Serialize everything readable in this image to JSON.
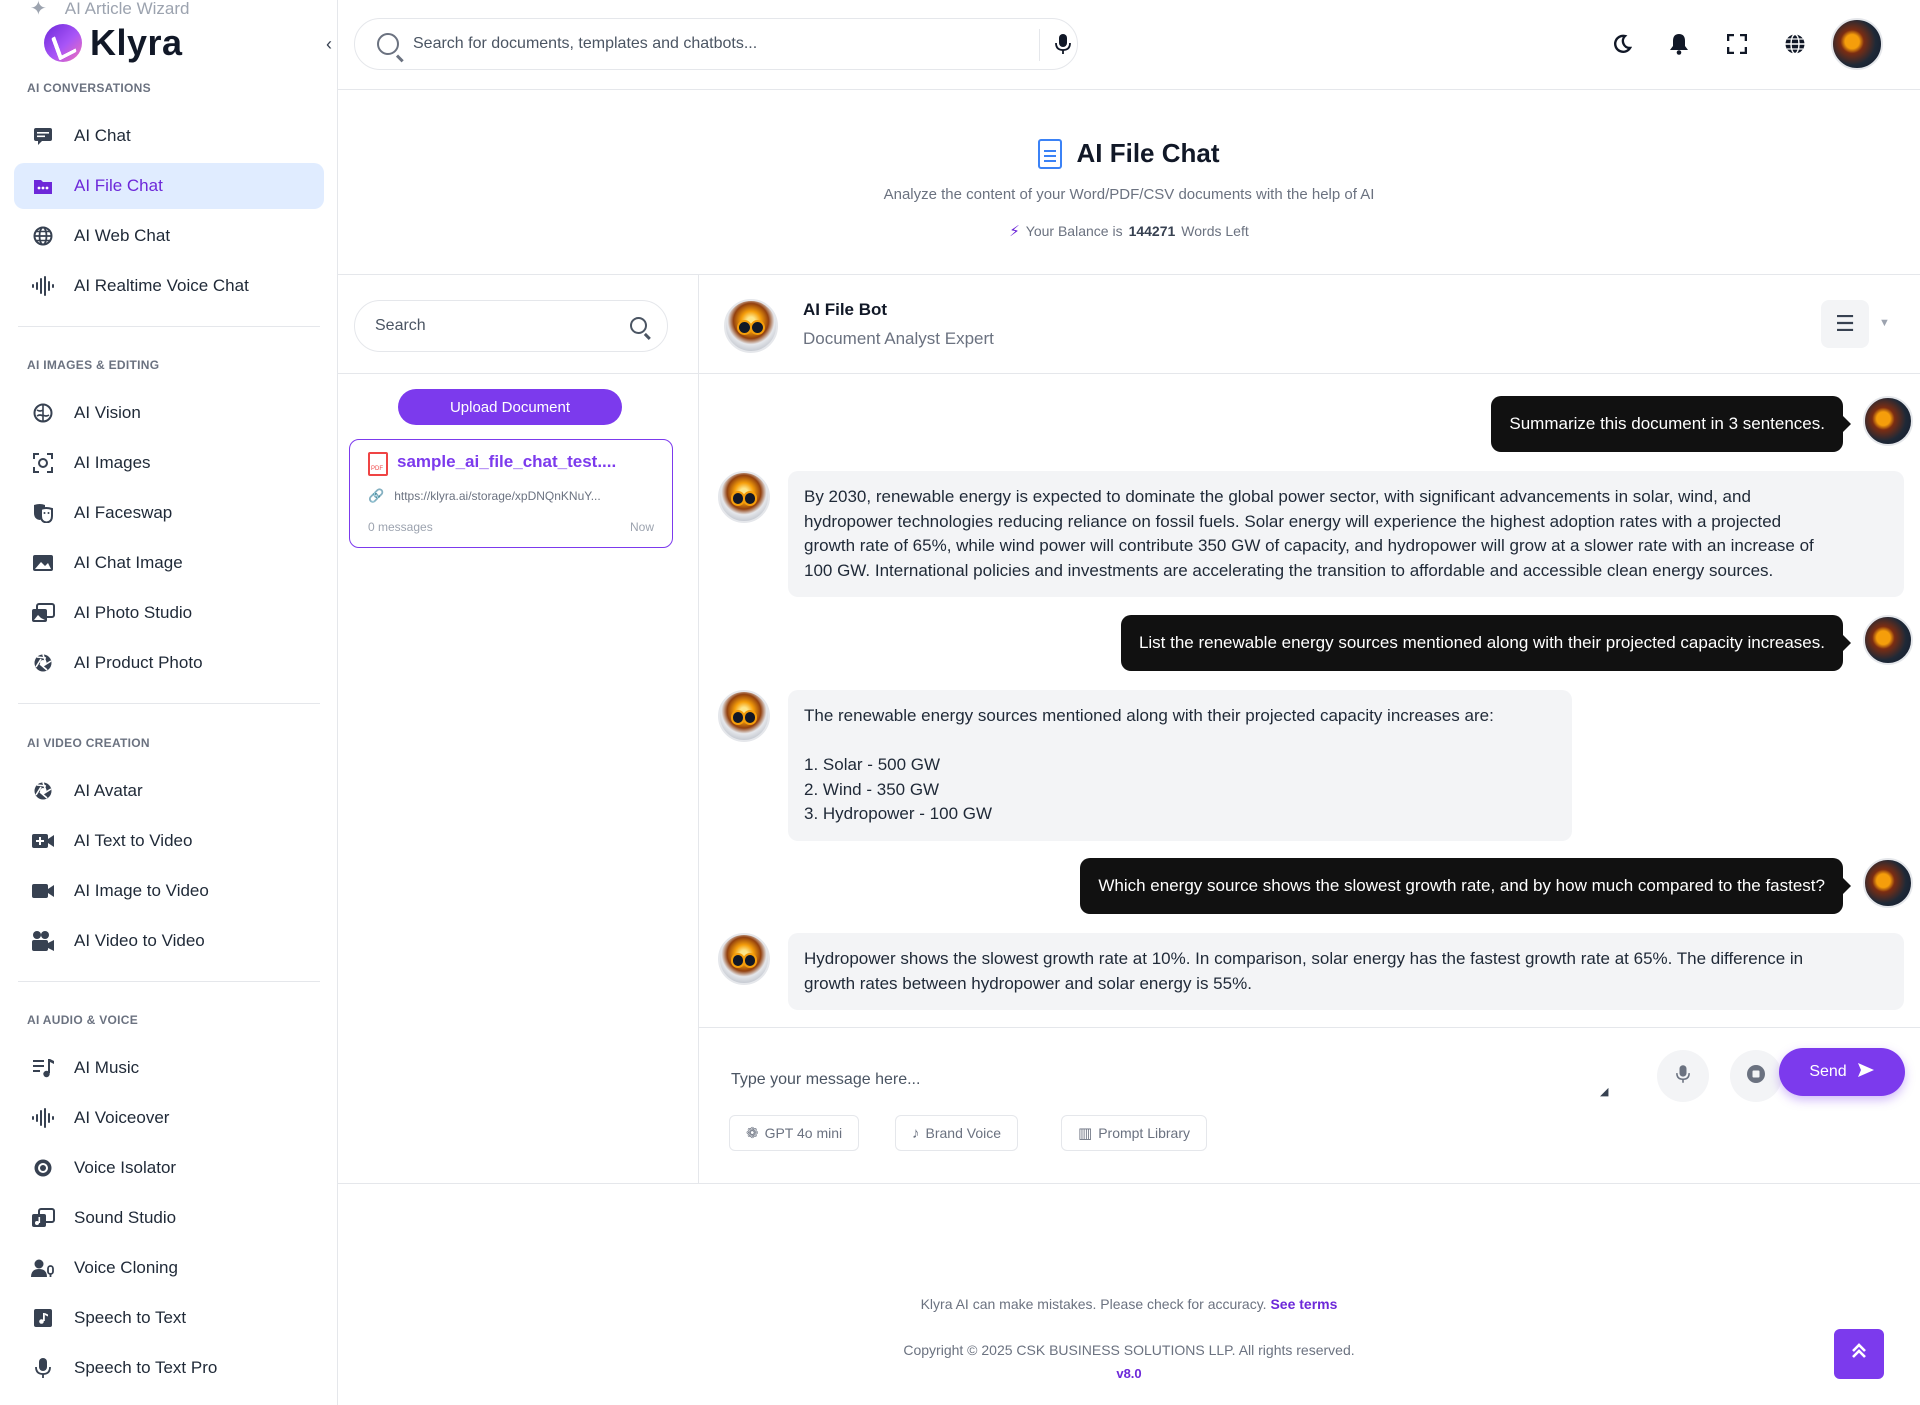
{
  "sidebar": {
    "peek_item": "AI Article Wizard",
    "brand": "Klyra",
    "sections": [
      {
        "label": "AI CONVERSATIONS",
        "items": [
          {
            "label": "AI Chat",
            "icon": "chat-icon"
          },
          {
            "label": "AI File Chat",
            "icon": "file-chat-icon",
            "active": true
          },
          {
            "label": "AI Web Chat",
            "icon": "globe-icon"
          },
          {
            "label": "AI Realtime Voice Chat",
            "icon": "waveform-icon"
          }
        ]
      },
      {
        "label": "AI IMAGES & EDITING",
        "items": [
          {
            "label": "AI Vision",
            "icon": "brain-icon"
          },
          {
            "label": "AI Images",
            "icon": "image-scan-icon"
          },
          {
            "label": "AI Faceswap",
            "icon": "masks-icon"
          },
          {
            "label": "AI Chat Image",
            "icon": "picture-icon"
          },
          {
            "label": "AI Photo Studio",
            "icon": "photo-studio-icon"
          },
          {
            "label": "AI Product Photo",
            "icon": "aperture-icon"
          }
        ]
      },
      {
        "label": "AI VIDEO CREATION",
        "items": [
          {
            "label": "AI Avatar",
            "icon": "aperture-icon"
          },
          {
            "label": "AI Text to Video",
            "icon": "video-plus-icon"
          },
          {
            "label": "AI Image to Video",
            "icon": "video-camera-icon"
          },
          {
            "label": "AI Video to Video",
            "icon": "film-camera-icon"
          }
        ]
      },
      {
        "label": "AI AUDIO & VOICE",
        "items": [
          {
            "label": "AI Music",
            "icon": "music-list-icon"
          },
          {
            "label": "AI Voiceover",
            "icon": "waveform-icon"
          },
          {
            "label": "Voice Isolator",
            "icon": "target-icon"
          },
          {
            "label": "Sound Studio",
            "icon": "sound-studio-icon"
          },
          {
            "label": "Voice Cloning",
            "icon": "user-voice-icon"
          },
          {
            "label": "Speech to Text",
            "icon": "music-file-icon"
          },
          {
            "label": "Speech to Text Pro",
            "icon": "microphone-icon"
          }
        ]
      }
    ]
  },
  "topbar": {
    "search_placeholder": "Search for documents, templates and chatbots...",
    "icons": [
      "moon-icon",
      "bell-icon",
      "fullscreen-icon",
      "globe-icon"
    ]
  },
  "page": {
    "title": "AI File Chat",
    "subtitle": "Analyze the content of your Word/PDF/CSV documents with the help of AI",
    "balance_prefix": "Your Balance is",
    "balance_value": "144271",
    "balance_suffix": "Words Left"
  },
  "files": {
    "search_placeholder": "Search",
    "upload_label": "Upload Document",
    "items": [
      {
        "name": "sample_ai_file_chat_test....",
        "url": "https://klyra.ai/storage/xpDNQnKNuY...",
        "messages": "0 messages",
        "time": "Now"
      }
    ]
  },
  "chat": {
    "bot_name": "AI File Bot",
    "bot_role": "Document Analyst Expert",
    "messages": [
      {
        "role": "user",
        "text": "Summarize this document in 3 sentences."
      },
      {
        "role": "bot",
        "lines": [
          "By 2030, renewable energy is expected to dominate the global power sector, with significant advancements in solar, wind, and",
          "hydropower technologies reducing reliance on fossil fuels. Solar energy will experience the highest adoption rates with a projected",
          "growth rate of 65%, while wind power will contribute 350 GW of capacity, and hydropower will grow at a slower rate with an increase of",
          "100 GW. International policies and investments are accelerating the transition to affordable and accessible clean energy sources."
        ]
      },
      {
        "role": "user",
        "text": "List the renewable energy sources mentioned along with their projected capacity increases."
      },
      {
        "role": "bot",
        "lines": [
          "The renewable energy sources mentioned along with their projected capacity increases are:",
          "",
          "1. Solar - 500 GW",
          "2. Wind - 350 GW",
          "3. Hydropower - 100 GW"
        ]
      },
      {
        "role": "user",
        "text": "Which energy source shows the slowest growth rate, and by how much compared to the fastest?"
      },
      {
        "role": "bot",
        "lines": [
          "Hydropower shows the slowest growth rate at 10%. In comparison, solar energy has the fastest growth rate at 65%. The difference in",
          "growth rates between hydropower and solar energy is 55%."
        ]
      }
    ],
    "input_placeholder": "Type your message here...",
    "send_label": "Send",
    "chips": [
      {
        "label": "GPT 4o mini",
        "icon": "openai-icon"
      },
      {
        "label": "Brand Voice",
        "icon": "brand-voice-icon"
      },
      {
        "label": "Prompt Library",
        "icon": "book-icon"
      }
    ]
  },
  "footer": {
    "disclaimer": "Klyra AI can make mistakes. Please check for accuracy.",
    "terms_link": "See terms",
    "copyright": "Copyright © 2025 CSK BUSINESS SOLUTIONS LLP. All rights reserved.",
    "version": "v8.0"
  },
  "colors": {
    "accent": "#7c3aed",
    "active_bg": "#e0ecff",
    "user_bubble": "#111111",
    "bot_bubble": "#f3f4f6"
  }
}
